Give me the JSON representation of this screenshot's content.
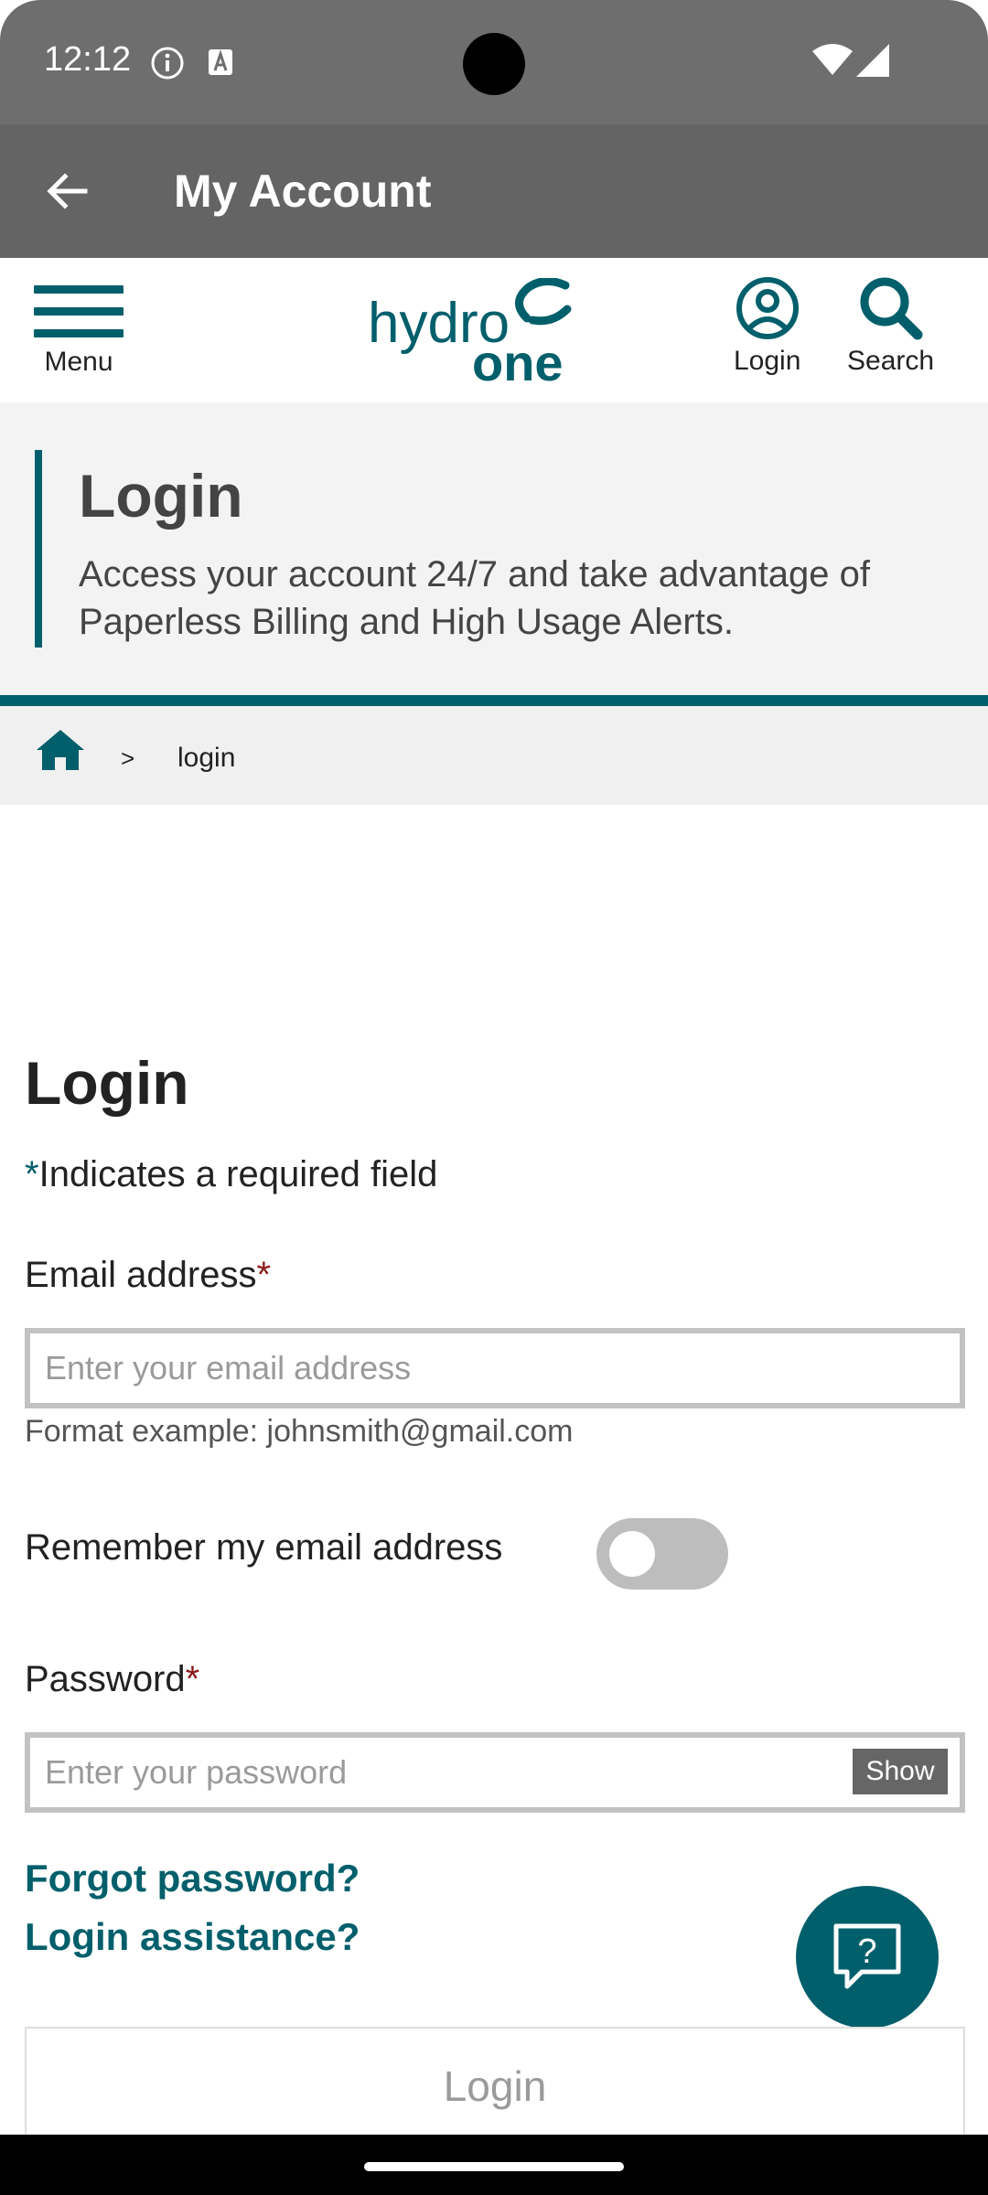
{
  "status_bar": {
    "time": "12:12"
  },
  "app_bar": {
    "title": "My Account"
  },
  "site_header": {
    "menu_label": "Menu",
    "login_label": "Login",
    "search_label": "Search"
  },
  "hero": {
    "title": "Login",
    "text": "Access your account 24/7 and take advantage of Paperless Billing and High Usage Alerts."
  },
  "breadcrumb": {
    "separator": ">",
    "current": "login"
  },
  "form": {
    "title": "Login",
    "required_star": "*",
    "required_note": "Indicates a required field",
    "email_label": "Email address",
    "email_placeholder": "Enter your email address",
    "email_hint": "Format example: johnsmith@gmail.com",
    "remember_label": "Remember my email address",
    "remember_on": false,
    "password_label": "Password",
    "password_placeholder": "Enter your password",
    "show_label": "Show",
    "forgot_link": "Forgot password?",
    "assistance_link": "Login assistance?",
    "submit_label": "Login"
  },
  "colors": {
    "brand_teal": "#005f6b",
    "app_bar_gray": "#646464",
    "required_red": "#8b1a1a"
  }
}
